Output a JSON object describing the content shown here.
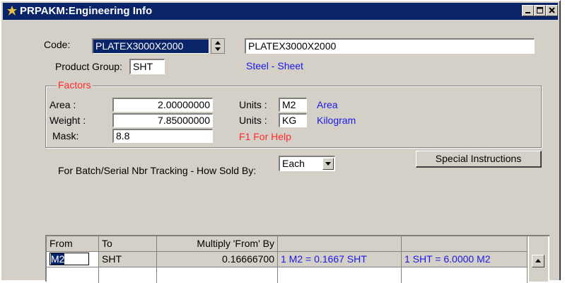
{
  "window": {
    "title": "PRPAKM:Engineering Info"
  },
  "code": {
    "label": "Code:",
    "value": "PLATEX3000X2000",
    "description": "PLATEX3000X2000"
  },
  "product_group": {
    "label": "Product Group:",
    "value": "SHT",
    "description": "Steel - Sheet"
  },
  "factors": {
    "title": "Factors",
    "area": {
      "label": "Area :",
      "value": "2.00000000",
      "units_label": "Units :",
      "units_value": "M2",
      "units_desc": "Area"
    },
    "weight": {
      "label": "Weight :",
      "value": "7.85000000",
      "units_label": "Units :",
      "units_value": "KG",
      "units_desc": "Kilogram"
    },
    "mask": {
      "label": "Mask:",
      "value": "8.8",
      "help": "F1 For Help"
    }
  },
  "tracking": {
    "label": "For Batch/Serial Nbr Tracking - How Sold By:",
    "value": "Each"
  },
  "special_instructions": {
    "label": "Special Instructions"
  },
  "grid": {
    "headers": [
      "From",
      "To",
      "Multiply 'From' By",
      "",
      ""
    ],
    "rows": [
      [
        "M2",
        "SHT",
        "0.16666700",
        "1 M2  = 0.1667 SHT",
        "1 SHT = 6.0000 M2"
      ]
    ]
  },
  "colors": {
    "title_bg": "#0a246a",
    "link_blue": "#1a1ae6",
    "help_red": "#ff2a2a",
    "face": "#d4d0c8"
  }
}
